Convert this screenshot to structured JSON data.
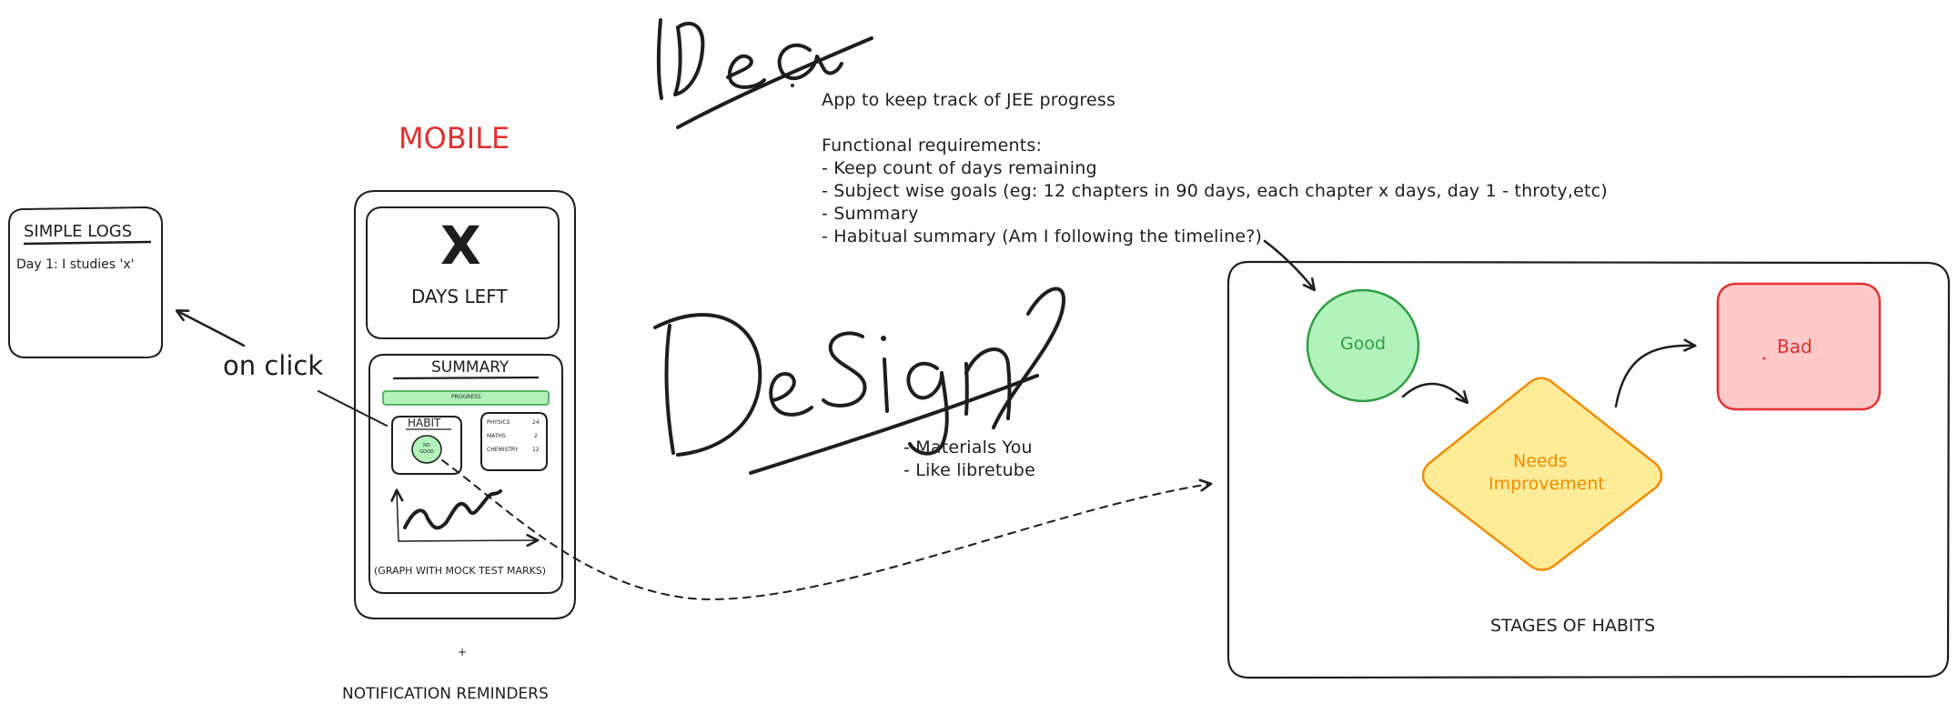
{
  "idea": {
    "heading": "Idea",
    "intro": "App to keep track of JEE progress",
    "req_title": "Functional requirements:",
    "requirements": [
      "- Keep count of days remaining",
      "- Subject wise goals (eg: 12 chapters in 90 days, each chapter x days, day 1 - throty,etc)",
      "- Summary",
      "- Habitual summary (Am I following the timeline?)"
    ]
  },
  "design": {
    "heading": "Design",
    "notes": [
      "- Materials You",
      "- Like libretube"
    ]
  },
  "mobile": {
    "title": "MOBILE",
    "title_color": "#e03131",
    "days_value": "X",
    "days_label": "DAYS LEFT",
    "summary_title": "SUMMARY",
    "progress_label": "PROGRESS",
    "habit_label": "HABIT",
    "habit_badge": "NO GOOD",
    "subjects": [
      {
        "name": "PHYSICS",
        "count": "24"
      },
      {
        "name": "MATHS",
        "count": "2"
      },
      {
        "name": "CHEMISTRY",
        "count": "12"
      }
    ],
    "graph_caption": "(GRAPH WITH MOCK TEST MARKS)",
    "notification_mark": "+",
    "notification_label": "NOTIFICATION REMINDERS"
  },
  "logs": {
    "title": "SIMPLE LOGS",
    "entry": "Day 1: I studies 'x'",
    "arrow_label": "on click"
  },
  "habits": {
    "caption": "STAGES OF HABITS",
    "stages": [
      {
        "label": "Good",
        "fill": "#b2f2bb",
        "stroke": "#2f9e44",
        "text": "#2f9e44"
      },
      {
        "label": "Needs Improvement",
        "line1": "Needs",
        "line2": "Improvement",
        "fill": "#ffec99",
        "stroke": "#f08c00",
        "text": "#f08c00"
      },
      {
        "label": "Bad",
        "fill": "#ffc9c9",
        "stroke": "#e03131",
        "text": "#e03131"
      }
    ]
  },
  "colors": {
    "ink": "#1e1e1e",
    "progress_fill": "#b2f2bb",
    "progress_stroke": "#2f9e44"
  }
}
